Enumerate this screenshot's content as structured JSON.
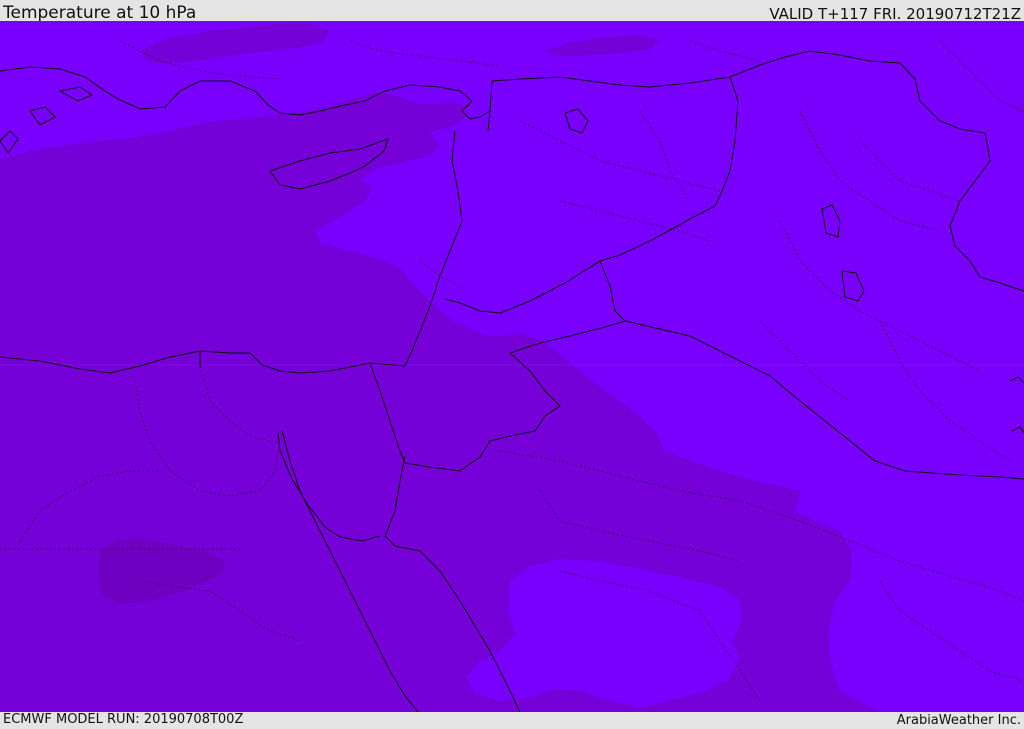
{
  "header": {
    "title": "Temperature at 10 hPa",
    "valid": "VALID T+117 FRI. 20190712T21Z"
  },
  "footer": {
    "model_run": "ECMWF MODEL RUN: 20190708T00Z",
    "credit": "ArabiaWeather Inc."
  },
  "map": {
    "colors": {
      "warm_band": "#7600d8",
      "cool_band": "#7a00fe",
      "warmest_patch": "#6e00c2",
      "outline": "#111111"
    },
    "icons": [
      "coastline",
      "country-border",
      "province-border"
    ]
  }
}
